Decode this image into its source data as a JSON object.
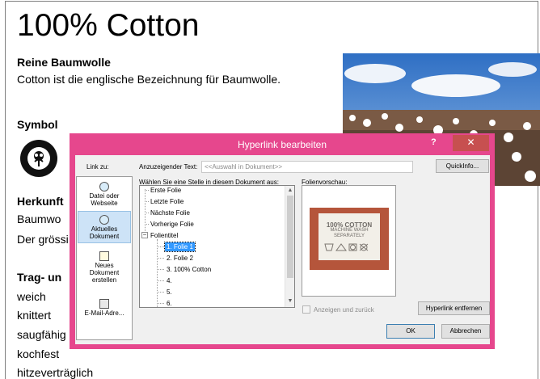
{
  "slide": {
    "title": "100% Cotton",
    "heading_1": "Reine Baumwolle",
    "line_1": "Cotton ist die englische Bezeichnung für Baumwolle.",
    "heading_2": "Symbol",
    "heading_3": "Herkunft",
    "line_herkunft_1": "Baumwo",
    "line_herkunft_2": "Der grössi",
    "heading_4": "Trag- un",
    "properties": [
      "weich",
      "knittert",
      "saugfähig",
      "kochfest",
      "hitzeverträglich"
    ]
  },
  "dialog": {
    "title": "Hyperlink bearbeiten",
    "help": "?",
    "close": "✕",
    "link_to_label": "Link zu:",
    "display_text_label": "Anzuzeigender Text:",
    "display_text_value": "<<Auswahl in Dokument>>",
    "quickinfo_button": "QuickInfo...",
    "select_place_label": "Wählen Sie eine Stelle in diesem Dokument aus:",
    "preview_label": "Folienvorschau:",
    "linkbar": [
      {
        "line1": "Datei oder",
        "line2": "Webseite",
        "line3": "",
        "icon": "file-web-icon"
      },
      {
        "line1": "Aktuelles",
        "line2": "Dokument",
        "line3": "",
        "icon": "current-document-icon"
      },
      {
        "line1": "Neues",
        "line2": "Dokument",
        "line3": "erstellen",
        "icon": "new-document-icon"
      },
      {
        "line1": "E-Mail-Adre...",
        "line2": "",
        "line3": "",
        "icon": "email-icon"
      }
    ],
    "tree": {
      "first_slide": "Erste Folie",
      "last_slide": "Letzte Folie",
      "next_slide": "Nächste Folie",
      "prev_slide": "Vorherige Folie",
      "slide_titles": "Folientitel",
      "toggle": "−",
      "slides": [
        "1. Folie 1",
        "2. Folie 2",
        "3. 100% Cotton",
        "4.",
        "5.",
        "6."
      ]
    },
    "preview_image": {
      "line1": "100% COTTON",
      "line2": "MACHINE WASH",
      "line3": "SEPARATELY"
    },
    "show_and_return_label": "Anzeigen und zurück",
    "remove_link_button": "Hyperlink entfernen",
    "ok_button": "OK",
    "cancel_button": "Abbrechen",
    "colors": {
      "titlebar": "#e6478d",
      "selection": "#3399ff",
      "close": "#c75050"
    }
  }
}
